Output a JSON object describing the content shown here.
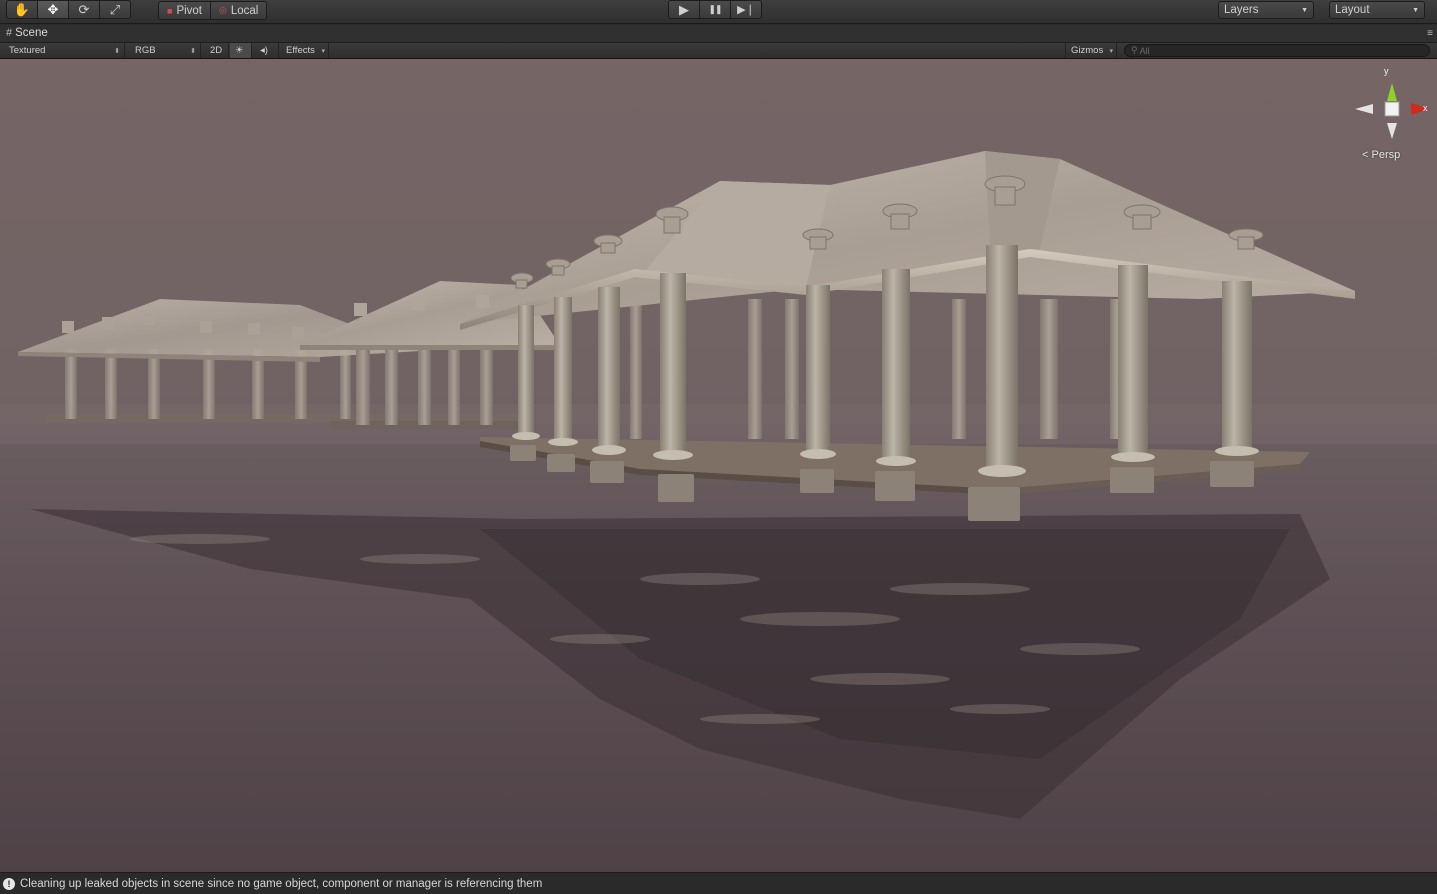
{
  "toolbar": {
    "transform_tools": [
      {
        "name": "hand-tool",
        "glyph": "✋",
        "active": false
      },
      {
        "name": "move-tool",
        "glyph": "✥",
        "active": true
      },
      {
        "name": "rotate-tool",
        "glyph": "⟳",
        "active": false
      },
      {
        "name": "scale-tool",
        "glyph": "⤢",
        "active": false
      }
    ],
    "pivot_label": "Pivot",
    "local_label": "Local",
    "play_glyph": "▶",
    "pause_glyph": "❚❚",
    "step_glyph": "▶❘",
    "layers_label": "Layers",
    "layout_label": "Layout"
  },
  "scene_tab": {
    "title": "Scene",
    "icon": "grid-icon",
    "menu_icon": "≡"
  },
  "scene_bar": {
    "render_mode": "Textured",
    "color_mode": "RGB",
    "mode_2d": "2D",
    "lighting_glyph": "☀",
    "audio_glyph": "◂)",
    "effects_label": "Effects",
    "gizmos_label": "Gizmos",
    "search_placeholder": "All"
  },
  "viewport": {
    "projection_label": "Persp",
    "axis_y": "y",
    "axis_x": "x",
    "colors": {
      "sky": "#766565",
      "water": "#58494d",
      "roof": "#b2a79c",
      "pillar": "#a59c90",
      "deck": "#7e7065",
      "gizmo_x": "#d22a1e",
      "gizmo_y": "#8fd12c"
    }
  },
  "status": {
    "message": "Cleaning up leaked objects in scene since no game object, component or manager is referencing them"
  }
}
